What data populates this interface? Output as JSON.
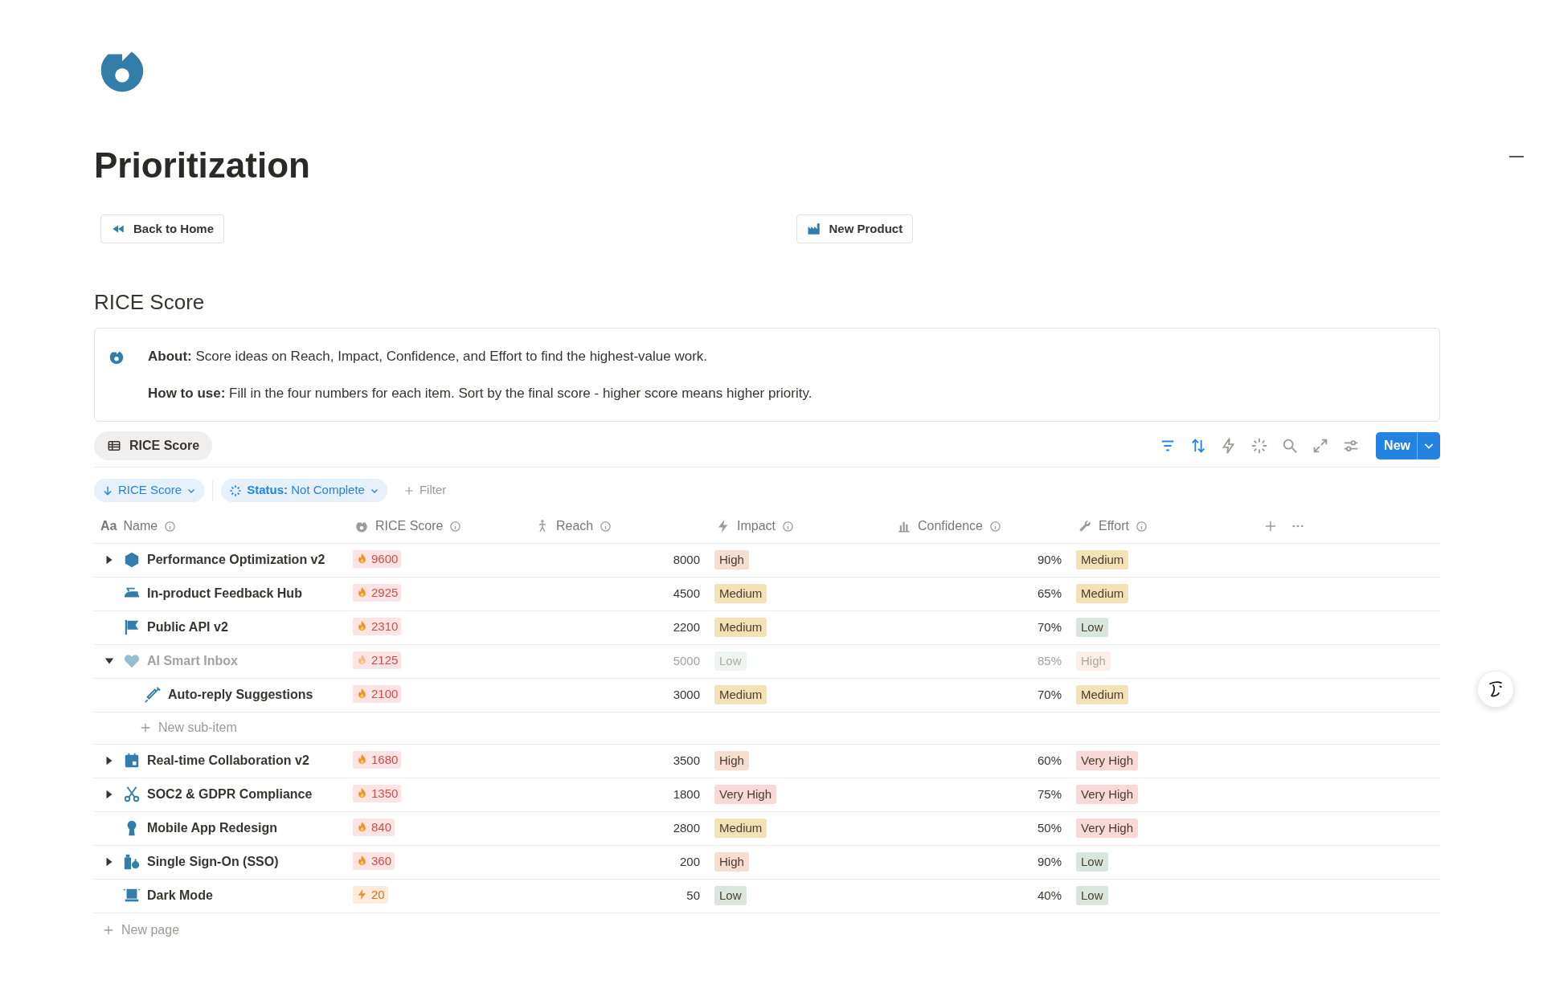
{
  "title": "Prioritization",
  "buttons": [
    {
      "label": "Back to Home",
      "kind": "rewind"
    },
    {
      "label": "New Product",
      "kind": "factory"
    }
  ],
  "section_title": "RICE Score",
  "callout": {
    "lines": [
      "**About:** Score ideas on Reach, Impact, Confidence, and Effort to find the highest-value work.",
      "**How to use:** Fill in the four numbers for each item. Sort by the final score - higher score means higher priority."
    ]
  },
  "view_tabs": [
    {
      "label": "RICE Score",
      "selected": true
    }
  ],
  "toolbar": {
    "filter_active": true,
    "sort_active": true,
    "new_button": "New"
  },
  "filters": [
    {
      "label": "RICE Score",
      "kind": "sort"
    },
    {
      "label": "**Status:** Not Complete",
      "kind": "status"
    }
  ],
  "add_filter": "Filter",
  "table": {
    "columns": [
      {
        "label": "Name",
        "kind": "title",
        "glyph": "Aa"
      },
      {
        "label": "RICE Score",
        "kind": "formula"
      },
      {
        "label": "Reach",
        "kind": "reach"
      },
      {
        "label": "Impact",
        "kind": "impact"
      },
      {
        "label": "Confidence",
        "kind": "confidence"
      },
      {
        "label": "Effort",
        "kind": "effort"
      }
    ],
    "rows": [
      {
        "name": "Performance Optimization v2",
        "has_children": true,
        "expanded": false,
        "dimmed": false,
        "score": "9600",
        "score_hot": true,
        "reach": "8000",
        "impact": {
          "label": "High",
          "color": "#f6ddd0"
        },
        "confidence": "90%",
        "effort": {
          "label": "Medium",
          "color": "#f3e2b6"
        }
      },
      {
        "name": "In-product Feedback Hub",
        "has_children": false,
        "dimmed": false,
        "score": "2925",
        "score_hot": true,
        "reach": "4500",
        "impact": {
          "label": "Medium",
          "color": "#f3e2b6"
        },
        "confidence": "65%",
        "effort": {
          "label": "Medium",
          "color": "#f3e2b6"
        }
      },
      {
        "name": "Public API v2",
        "has_children": false,
        "dimmed": false,
        "score": "2310",
        "score_hot": true,
        "reach": "2200",
        "impact": {
          "label": "Medium",
          "color": "#f3e2b6"
        },
        "confidence": "70%",
        "effort": {
          "label": "Low",
          "color": "#d9e6dd"
        }
      },
      {
        "name": "AI Smart Inbox",
        "has_children": true,
        "expanded": true,
        "dimmed": true,
        "score": "2125",
        "score_hot": true,
        "reach": "5000",
        "impact": {
          "label": "Low",
          "color": "#eef4f0"
        },
        "confidence": "85%",
        "effort": {
          "label": "High",
          "color": "#fbefe8"
        },
        "children": [
          {
            "name": "Auto-reply Suggestions",
            "has_children": false,
            "dimmed": false,
            "score": "2100",
            "score_hot": true,
            "reach": "3000",
            "impact": {
              "label": "Medium",
              "color": "#f3e2b6"
            },
            "confidence": "70%",
            "effort": {
              "label": "Medium",
              "color": "#f3e2b6"
            }
          }
        ],
        "new_sub_item": "New sub-item"
      },
      {
        "name": "Real-time Collaboration v2",
        "has_children": true,
        "expanded": false,
        "dimmed": false,
        "score": "1680",
        "score_hot": true,
        "reach": "3500",
        "impact": {
          "label": "High",
          "color": "#f6ddd0"
        },
        "confidence": "60%",
        "effort": {
          "label": "Very High",
          "color": "#f9d8d8"
        }
      },
      {
        "name": "SOC2 & GDPR Compliance",
        "has_children": true,
        "expanded": false,
        "dimmed": false,
        "score": "1350",
        "score_hot": true,
        "reach": "1800",
        "impact": {
          "label": "Very High",
          "color": "#f9d8d8"
        },
        "confidence": "75%",
        "effort": {
          "label": "Very High",
          "color": "#f9d8d8"
        }
      },
      {
        "name": "Mobile App Redesign",
        "has_children": false,
        "dimmed": false,
        "score": "840",
        "score_hot": true,
        "reach": "2800",
        "impact": {
          "label": "Medium",
          "color": "#f3e2b6"
        },
        "confidence": "50%",
        "effort": {
          "label": "Very High",
          "color": "#f9d8d8"
        }
      },
      {
        "name": "Single Sign-On (SSO)",
        "has_children": true,
        "expanded": false,
        "dimmed": false,
        "score": "360",
        "score_hot": true,
        "reach": "200",
        "impact": {
          "label": "High",
          "color": "#f6ddd0"
        },
        "confidence": "90%",
        "effort": {
          "label": "Low",
          "color": "#d9e6dd"
        }
      },
      {
        "name": "Dark Mode",
        "has_children": false,
        "dimmed": false,
        "score": "20",
        "score_hot": false,
        "reach": "50",
        "impact": {
          "label": "Low",
          "color": "#d9e6dd"
        },
        "confidence": "40%",
        "effort": {
          "label": "Low",
          "color": "#d9e6dd"
        }
      }
    ],
    "new_page": "New page"
  }
}
